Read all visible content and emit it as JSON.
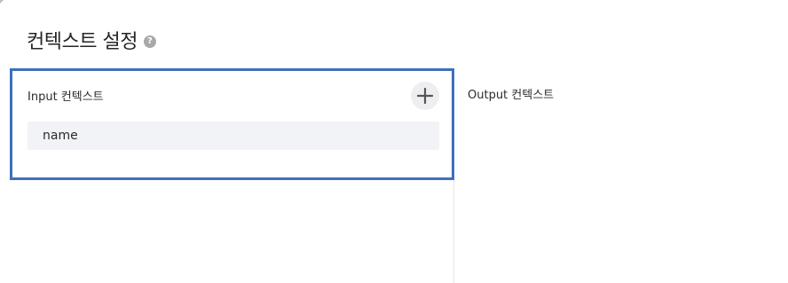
{
  "header": {
    "title": "컨텍스트 설정",
    "help_icon": "question-mark-circle-icon"
  },
  "input_context": {
    "label": "Input 컨텍스트",
    "add_icon": "plus-icon",
    "items": [
      {
        "name": "name"
      }
    ]
  },
  "output_context": {
    "label": "Output 컨텍스트"
  },
  "colors": {
    "selection_border": "#3d6fbe",
    "row_background": "#f2f3f6",
    "divider": "#e4e4e6"
  }
}
